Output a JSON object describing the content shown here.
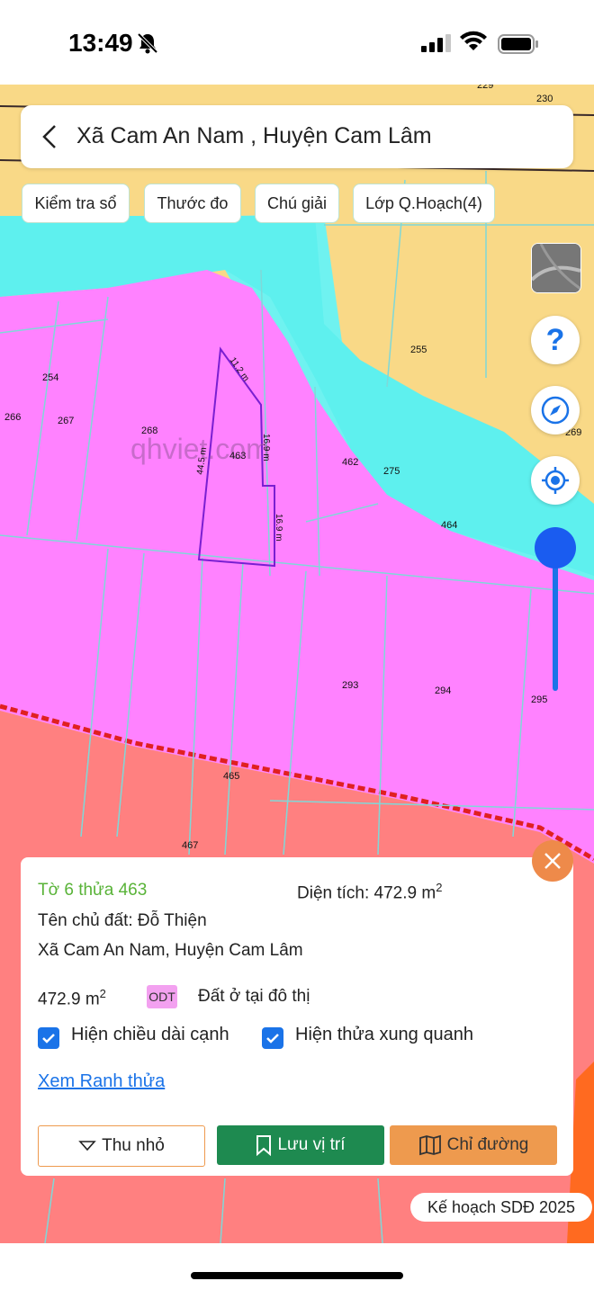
{
  "status_bar": {
    "time": "13:49"
  },
  "search": {
    "title": "Xã Cam An Nam , Huyện Cam Lâm"
  },
  "chips": [
    "Kiểm tra sổ",
    "Thước đo",
    "Chú giải",
    "Lớp Q.Hoạch(4)"
  ],
  "map": {
    "watermark": "qhviet.com",
    "parcel_labels": [
      "229",
      "230",
      "254",
      "266",
      "267",
      "268",
      "463",
      "462",
      "275",
      "464",
      "255",
      "269",
      "293",
      "294",
      "295",
      "465",
      "467"
    ],
    "edge_labels": [
      "11.2 m",
      "44.5 m",
      "16.9 m",
      "16.9 m"
    ]
  },
  "info": {
    "parcel": "Tờ 6 thửa 463",
    "area_label": "Diện tích: 472.9 m",
    "area_sup": "2",
    "owner": "Tên chủ đất: Đỗ Thiện",
    "location": "Xã Cam An Nam, Huyện Cam Lâm",
    "land_area": "472.9 m",
    "land_area_sup": "2",
    "land_code": "ODT",
    "land_type": "Đất ở tại đô thị",
    "show_edges": "Hiện chiều dài cạnh",
    "show_neighbors": "Hiện thửa xung quanh",
    "view_boundary": "Xem Ranh thửa",
    "btn_minimize": "Thu nhỏ",
    "btn_save": "Lưu vị trí",
    "btn_directions": "Chỉ đường"
  },
  "legend": "Kế hoạch SDĐ 2025",
  "colors": {
    "accent_green": "#1e8a50",
    "orange": "#ee9a4e",
    "blue": "#1a73e8"
  }
}
